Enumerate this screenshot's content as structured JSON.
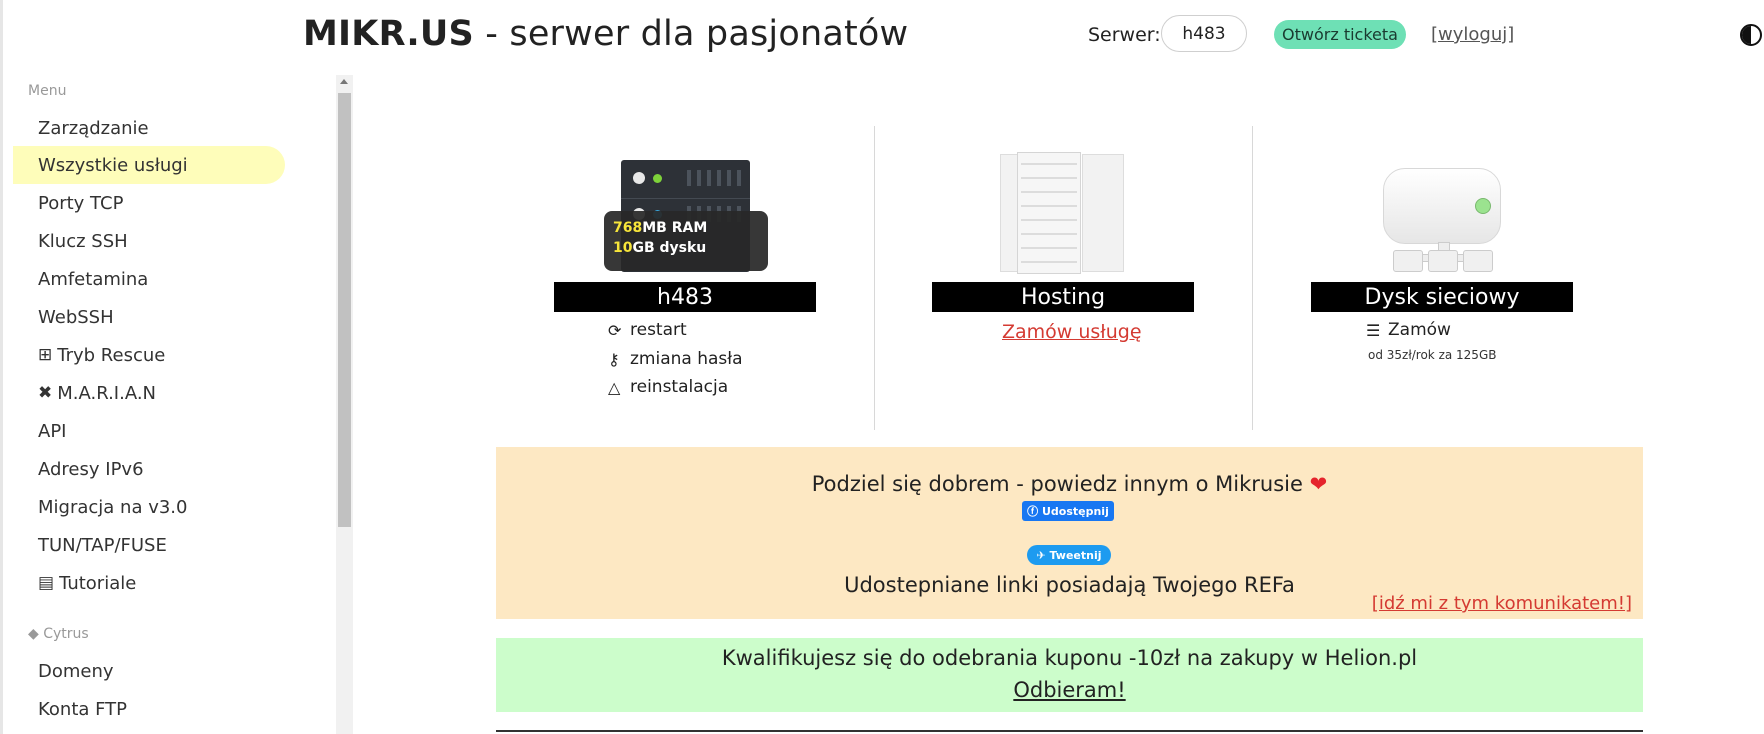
{
  "header": {
    "brand_bold": "MIKR.US",
    "brand_rest": " - serwer dla pasjonatów",
    "server_label": "Serwer:",
    "server_value": "h483",
    "ticket_button": "Otwórz ticketa",
    "logout": "[wyloguj]",
    "theme_icon": "contrast-icon"
  },
  "sidebar": {
    "section_menu": "Menu",
    "items": [
      {
        "label": "Zarządzanie",
        "icon": ""
      },
      {
        "label": "Wszystkie usługi",
        "icon": "",
        "active": true
      },
      {
        "label": "Porty TCP",
        "icon": ""
      },
      {
        "label": "Klucz SSH",
        "icon": ""
      },
      {
        "label": "Amfetamina",
        "icon": ""
      },
      {
        "label": "WebSSH",
        "icon": ""
      },
      {
        "label": "Tryb Rescue",
        "icon": "medkit-icon"
      },
      {
        "label": "M.A.R.I.A.N",
        "icon": "tools-icon"
      },
      {
        "label": "API",
        "icon": ""
      },
      {
        "label": "Adresy IPv6",
        "icon": ""
      },
      {
        "label": "Migracja na v3.0",
        "icon": ""
      },
      {
        "label": "TUN/TAP/FUSE",
        "icon": ""
      },
      {
        "label": "Tutoriale",
        "icon": "film-icon"
      }
    ],
    "section_cytrus": "Cytrus",
    "cytrus_items": [
      {
        "label": "Domeny"
      },
      {
        "label": "Konta FTP"
      }
    ]
  },
  "services": {
    "vps": {
      "ram_value": "768",
      "ram_unit": "MB RAM",
      "disk_value": "10",
      "disk_unit": "GB dysku",
      "title": "h483",
      "actions": [
        {
          "label": "restart",
          "icon": "refresh-icon"
        },
        {
          "label": "zmiana hasła",
          "icon": "key-icon"
        },
        {
          "label": "reinstalacja",
          "icon": "linux-icon"
        }
      ]
    },
    "hosting": {
      "title": "Hosting",
      "order_link": "Zamów usługę"
    },
    "disk": {
      "title": "Dysk sieciowy",
      "order_label": "Zamów",
      "order_icon": "database-icon",
      "price_note": "od 35zł/rok za 125GB"
    }
  },
  "share_banner": {
    "title": "Podziel się dobrem - powiedz innym o Mikrusie",
    "heart": "❤",
    "facebook_button": "Udostępnij",
    "twitter_button": "Tweetnij",
    "ref_text": "Udostepniane linki posiadają Twojego REFa",
    "dismiss": "[idź mi z tym komunikatem!]",
    "background": "#fde8c3"
  },
  "coupon_banner": {
    "text": "Kwalifikujesz się do odebrania kuponu -10zł na zakupy w Helion.pl",
    "link": "Odbieram!",
    "background": "#ccfdcb"
  },
  "colors": {
    "accent_button": "#6ee0b5",
    "active_nav": "#fefdba",
    "link_red": "#d43a32"
  }
}
